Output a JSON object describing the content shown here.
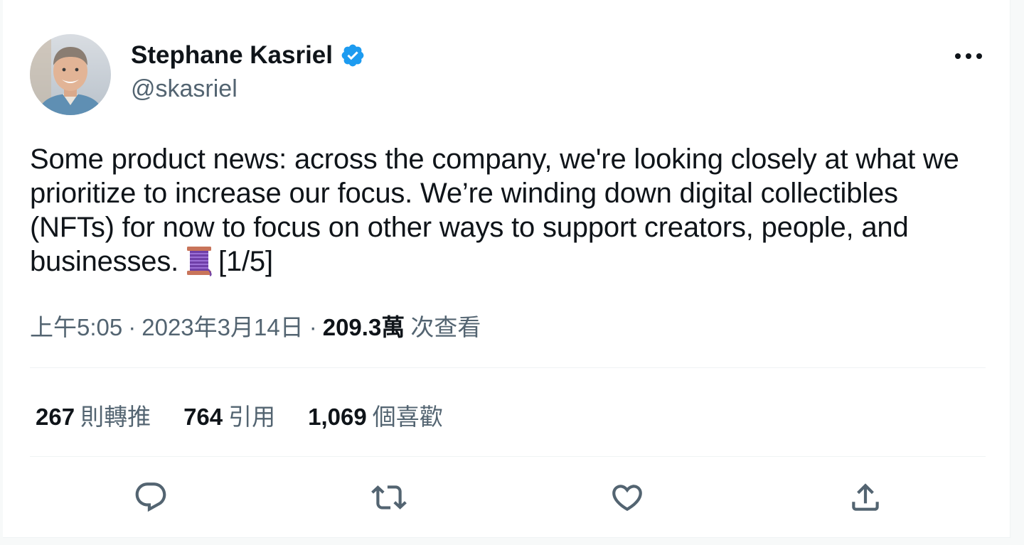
{
  "tweet": {
    "author": {
      "display_name": "Stephane Kasriel",
      "handle": "@skasriel",
      "verified": true,
      "verified_color": "#1d9bf0"
    },
    "text": "Some product news: across the company, we're looking closely at what we prioritize to increase our focus. We’re winding down digital collectibles (NFTs) for now to focus on other ways to support creators, people, and businesses.",
    "text_suffix": "[1/5]",
    "emoji": "spool-of-thread",
    "meta": {
      "time": "上午5:05",
      "separator": "·",
      "date": "2023年3月14日",
      "views_count": "209.3萬",
      "views_label": "次查看"
    },
    "stats": {
      "retweets": {
        "count": "267",
        "label": "則轉推"
      },
      "quotes": {
        "count": "764",
        "label": "引用"
      },
      "likes": {
        "count": "1,069",
        "label": "個喜歡"
      }
    },
    "actions": [
      "reply-icon",
      "retweet-icon",
      "like-icon",
      "share-icon"
    ]
  }
}
